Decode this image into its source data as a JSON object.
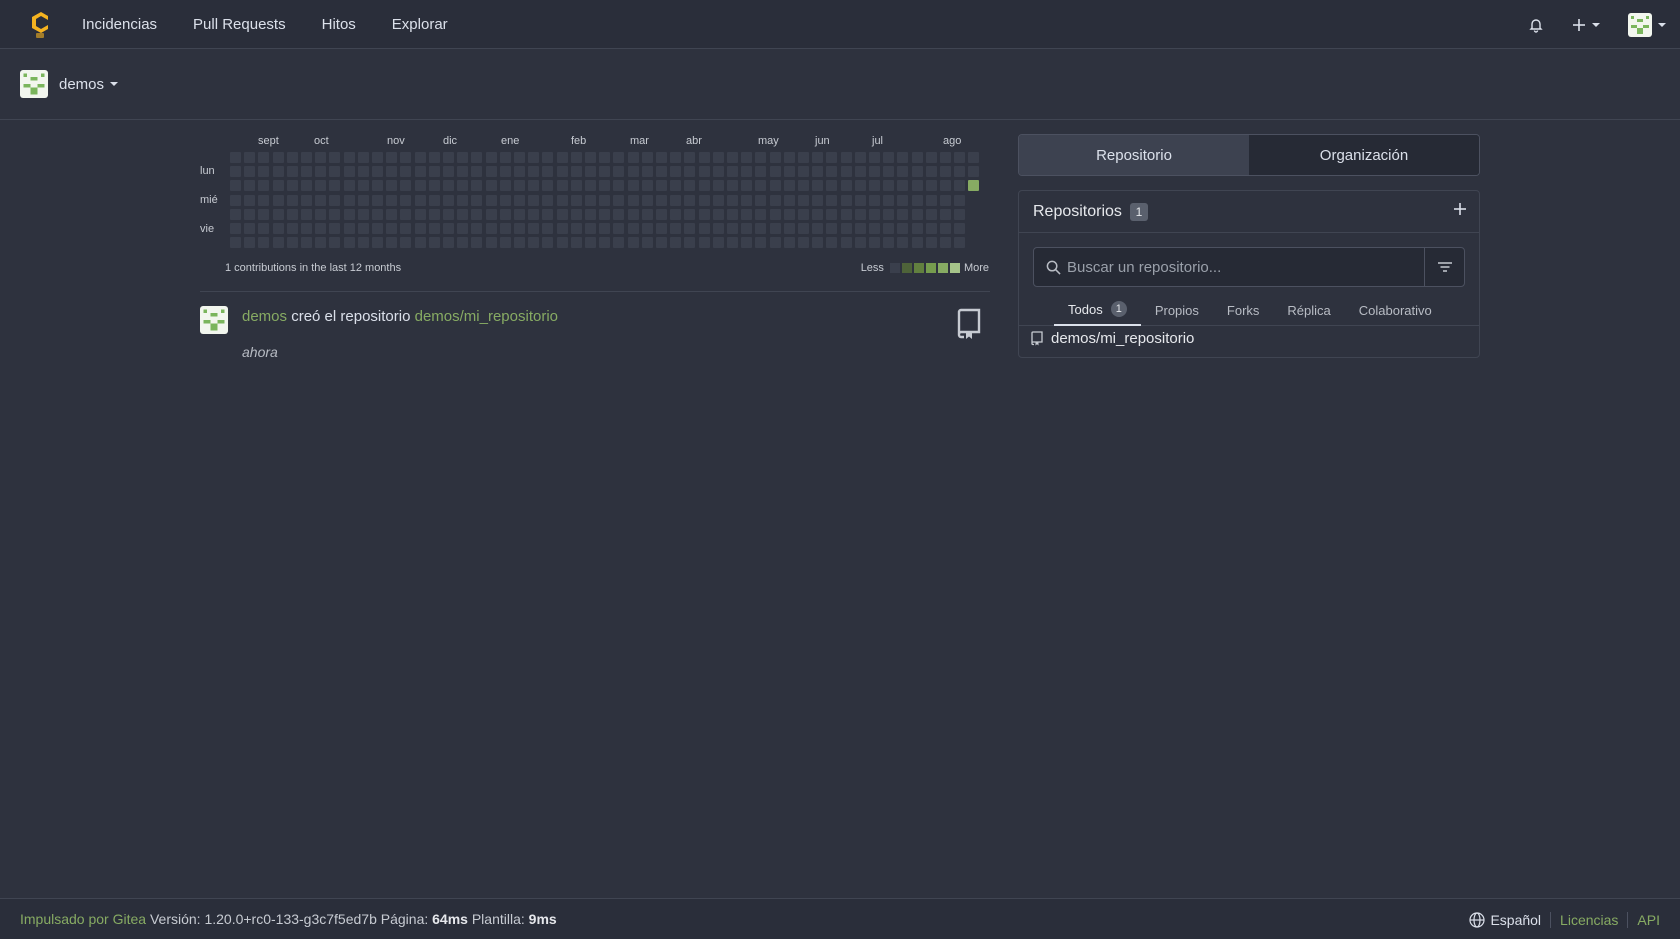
{
  "colors": {
    "accent": "#87ab63",
    "logo": "#f5b320",
    "cell_empty": "#3a3f4c"
  },
  "nav": {
    "items": [
      "Incidencias",
      "Pull Requests",
      "Hitos",
      "Explorar"
    ]
  },
  "context": {
    "username": "demos"
  },
  "heatmap": {
    "months": [
      "sept",
      "oct",
      "nov",
      "dic",
      "ene",
      "feb",
      "mar",
      "abr",
      "may",
      "jun",
      "jul",
      "ago"
    ],
    "days": [
      "lun",
      "mié",
      "vie"
    ],
    "summary": "1 contributions in the last 12 months",
    "legend_less": "Less",
    "legend_more": "More",
    "legend_colors": [
      "#3a3f4c",
      "#4e6339",
      "#62803f",
      "#769c4e",
      "#87ab63",
      "#a6c48a"
    ]
  },
  "feed": {
    "user": "demos",
    "action": "creó el repositorio",
    "repo": "demos/mi_repositorio",
    "time": "ahora"
  },
  "switcher": {
    "repo_label": "Repositorio",
    "org_label": "Organización"
  },
  "repos": {
    "title": "Repositorios",
    "count": "1",
    "search_placeholder": "Buscar un repositorio...",
    "tabs": [
      {
        "label": "Todos",
        "count": "1"
      },
      {
        "label": "Propios"
      },
      {
        "label": "Forks"
      },
      {
        "label": "Réplica"
      },
      {
        "label": "Colaborativo"
      }
    ],
    "items": [
      "demos/mi_repositorio"
    ]
  },
  "footer": {
    "powered": "Impulsado por Gitea",
    "version_label": "Versión:",
    "version": "1.20.0+rc0-133-g3c7f5ed7b",
    "page_label": "Página:",
    "page_time": "64ms",
    "template_label": "Plantilla:",
    "template_time": "9ms",
    "language": "Español",
    "licenses": "Licencias",
    "api": "API"
  }
}
